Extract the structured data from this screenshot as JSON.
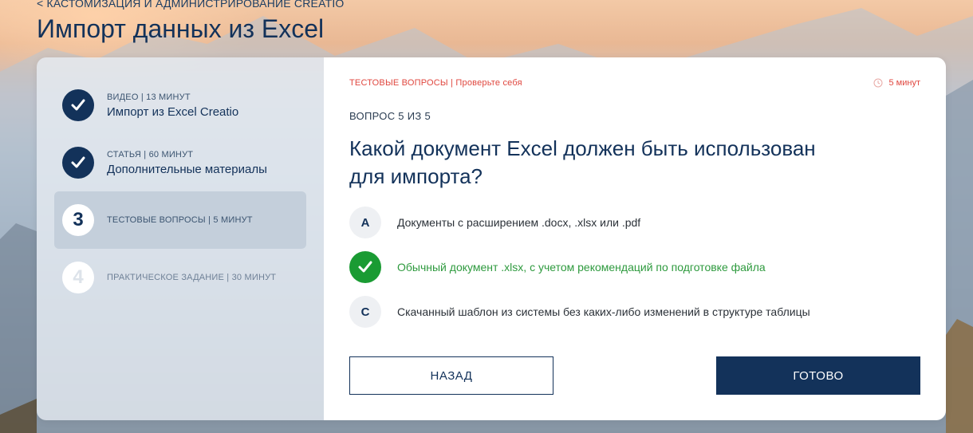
{
  "breadcrumb": "< КАСТОМИЗАЦИЯ И АДМИНИСТРИРОВАНИЕ CREATIO",
  "page_title": "Импорт данных из Excel",
  "steps": [
    {
      "number": "",
      "meta": "ВИДЕО | 13 МИНУТ",
      "title": "Импорт из Excel Creatio",
      "status": "done",
      "icon": "check-icon"
    },
    {
      "number": "",
      "meta": "СТАТЬЯ | 60 МИНУТ",
      "title": "Дополнительные материалы",
      "status": "done",
      "icon": "check-icon"
    },
    {
      "number": "3",
      "meta": "ТЕСТОВЫЕ ВОПРОСЫ | 5 МИНУТ",
      "title": "",
      "status": "active"
    },
    {
      "number": "4",
      "meta": "ПРАКТИЧЕСКОЕ ЗАДАНИЕ | 30 МИНУТ",
      "title": "",
      "status": "locked"
    }
  ],
  "main": {
    "section_label": "ТЕСТОВЫЕ ВОПРОСЫ | Проверьте себя",
    "timer": "5 минут",
    "timer_icon": "clock-icon",
    "question_counter": "ВОПРОС 5 ИЗ 5",
    "question": "Какой документ Excel должен быть использован для импорта?",
    "answers": [
      {
        "letter": "A",
        "text": "Документы с расширением .docx, .xlsx или .pdf",
        "selected": false
      },
      {
        "letter": "",
        "text": "Обычный документ .xlsx, с учетом рекомендаций по подготовке файла",
        "selected": true,
        "icon": "check-icon"
      },
      {
        "letter": "C",
        "text": "Скачанный шаблон из системы без каких-либо изменений в структуре таблицы",
        "selected": false
      }
    ],
    "back_label": "НАЗАД",
    "done_label": "ГОТОВО"
  },
  "colors": {
    "brand": "#13325a",
    "accent_red": "#e0473f",
    "correct_green": "#1a9b33"
  }
}
